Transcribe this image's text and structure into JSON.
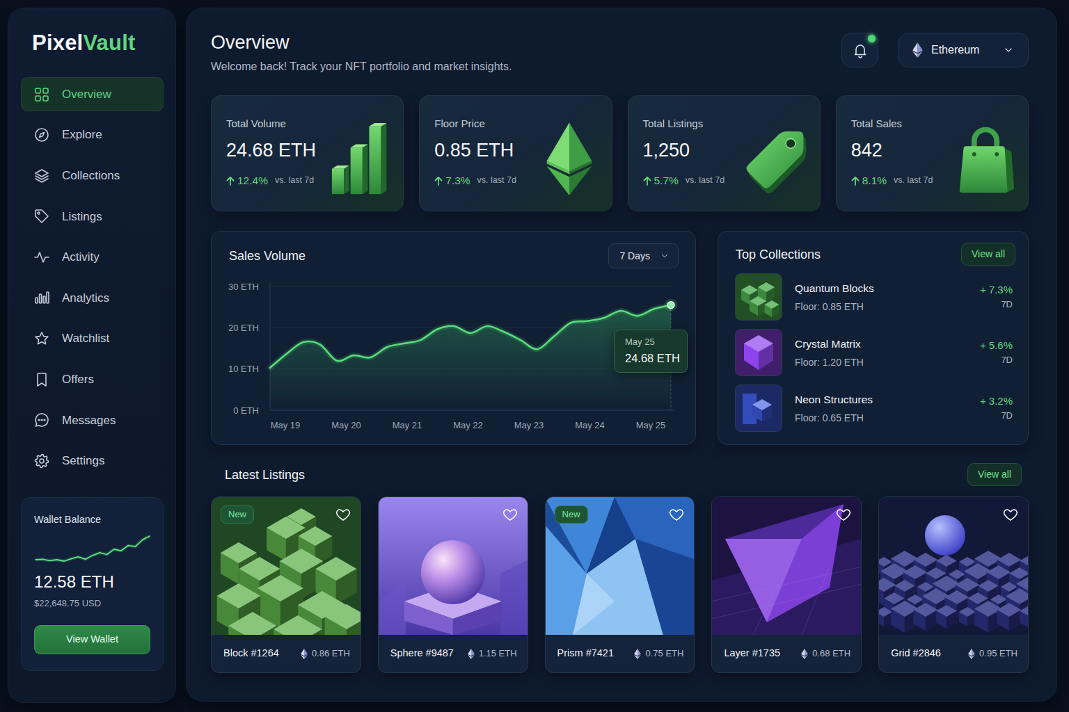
{
  "app": {
    "logo_first": "Pixel",
    "logo_second": "Vault"
  },
  "sidebar": {
    "items": [
      {
        "label": "Overview",
        "selected": true
      },
      {
        "label": "Explore",
        "selected": false
      },
      {
        "label": "Collections",
        "selected": false
      },
      {
        "label": "Listings",
        "selected": false
      },
      {
        "label": "Activity",
        "selected": false
      },
      {
        "label": "Analytics",
        "selected": false
      },
      {
        "label": "Watchlist",
        "selected": false
      },
      {
        "label": "Offers",
        "selected": false
      },
      {
        "label": "Messages",
        "selected": false
      },
      {
        "label": "Settings",
        "selected": false
      }
    ]
  },
  "wallet": {
    "title": "Wallet Balance",
    "balance": "12.58 ETH",
    "usd": "$22,648.75 USD",
    "button": "View Wallet",
    "trend": [
      3.0,
      3.1,
      2.8,
      3.0,
      2.7,
      3.2,
      3.6,
      3.1,
      3.9,
      4.5,
      4.1,
      5.2,
      4.9,
      6.0,
      5.8,
      7.2,
      8.0
    ]
  },
  "header": {
    "title": "Overview",
    "subtitle": "Welcome back! Track your NFT portfolio and market insights.",
    "notifications": {
      "unread": true
    },
    "network": "Ethereum"
  },
  "stats": [
    {
      "label": "Total Volume",
      "value": "24.68 ETH",
      "change": "12.4%",
      "compare": "vs. last 7d"
    },
    {
      "label": "Floor Price",
      "value": "0.85 ETH",
      "change": "7.3%",
      "compare": "vs. last 7d"
    },
    {
      "label": "Total Listings",
      "value": "1,250",
      "change": "5.7%",
      "compare": "vs. last 7d"
    },
    {
      "label": "Total Sales",
      "value": "842",
      "change": "8.1%",
      "compare": "vs. last 7d"
    }
  ],
  "sales_chart": {
    "title": "Sales Volume",
    "range": "7 Days",
    "y_ticks": [
      {
        "label": "30 ETH",
        "value": 30
      },
      {
        "label": "20 ETH",
        "value": 20
      },
      {
        "label": "10 ETH",
        "value": 10
      },
      {
        "label": "0 ETH",
        "value": 0
      }
    ],
    "x_labels": [
      "May 19",
      "May 20",
      "May 21",
      "May 22",
      "May 23",
      "May 24",
      "May 25"
    ],
    "values": [
      10.3,
      13.7,
      16.5,
      15.9,
      12.0,
      13.3,
      12.8,
      15.3,
      16.2,
      17.0,
      19.6,
      20.4,
      18.7,
      20.4,
      19.0,
      17.0,
      14.8,
      17.9,
      21.2,
      21.6,
      22.4,
      24.1,
      22.9,
      24.6,
      25.5
    ],
    "tooltip": {
      "label": "May 25",
      "value": "24.68 ETH"
    }
  },
  "top_collections": {
    "title": "Top Collections",
    "view_all": "View all",
    "items": [
      {
        "name": "Quantum Blocks",
        "floor": "Floor: 0.85 ETH",
        "change": "+ 7.3%",
        "period": "7D",
        "color": "#4caf50"
      },
      {
        "name": "Crystal Matrix",
        "floor": "Floor: 1.20 ETH",
        "change": "+ 5.6%",
        "period": "7D",
        "color": "#8e44ec"
      },
      {
        "name": "Neon Structures",
        "floor": "Floor: 0.65 ETH",
        "change": "+ 3.2%",
        "period": "7D",
        "color": "#3d5ce0"
      }
    ]
  },
  "latest_listings": {
    "title": "Latest Listings",
    "view_all": "View all",
    "new_label": "New",
    "items": [
      {
        "name": "Block #1264",
        "price": "0.86 ETH",
        "new": true,
        "favorited": false
      },
      {
        "name": "Sphere #9487",
        "price": "1.15 ETH",
        "new": false,
        "favorited": false
      },
      {
        "name": "Prism #7421",
        "price": "0.75 ETH",
        "new": true,
        "favorited": false
      },
      {
        "name": "Layer #1735",
        "price": "0.68 ETH",
        "new": false,
        "favorited": false
      },
      {
        "name": "Grid #2846",
        "price": "0.95 ETH",
        "new": false,
        "favorited": false
      }
    ]
  }
}
